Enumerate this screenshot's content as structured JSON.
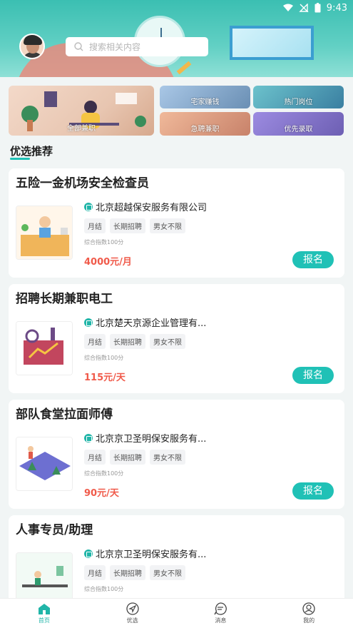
{
  "status": {
    "time": "9:43"
  },
  "search": {
    "placeholder": "搜索相关内容"
  },
  "banners": {
    "big": "全部兼职",
    "a": "宅家赚钱",
    "b": "热门岗位",
    "c": "急聘兼职",
    "d": "优先录取"
  },
  "section_title": "优选推荐",
  "jobs": [
    {
      "title": "五险一金机场安全检查员",
      "company": "北京超越保安服务有限公司",
      "tags": [
        "月结",
        "长期招聘",
        "男女不限"
      ],
      "score": "综合指数100分",
      "salary": "4000元/月",
      "apply": "报名"
    },
    {
      "title": "招聘长期兼职电工",
      "company": "北京楚天京源企业管理有...",
      "tags": [
        "月结",
        "长期招聘",
        "男女不限"
      ],
      "score": "综合指数100分",
      "salary": "115元/天",
      "apply": "报名"
    },
    {
      "title": "部队食堂拉面师傅",
      "company": "北京京卫圣明保安服务有...",
      "tags": [
        "月结",
        "长期招聘",
        "男女不限"
      ],
      "score": "综合指数100分",
      "salary": "90元/天",
      "apply": "报名"
    },
    {
      "title": "人事专员/助理",
      "company": "北京京卫圣明保安服务有...",
      "tags": [
        "月结",
        "长期招聘",
        "男女不限"
      ],
      "score": "综合指数100分",
      "salary": "",
      "apply": ""
    }
  ],
  "nav": [
    {
      "label": "首页",
      "icon": "home-icon"
    },
    {
      "label": "优选",
      "icon": "navigate-icon"
    },
    {
      "label": "消息",
      "icon": "message-icon"
    },
    {
      "label": "我的",
      "icon": "profile-icon"
    }
  ],
  "colors": {
    "accent": "#20c1b6",
    "salary": "#f05a4a",
    "header": "#3bbfb2"
  }
}
